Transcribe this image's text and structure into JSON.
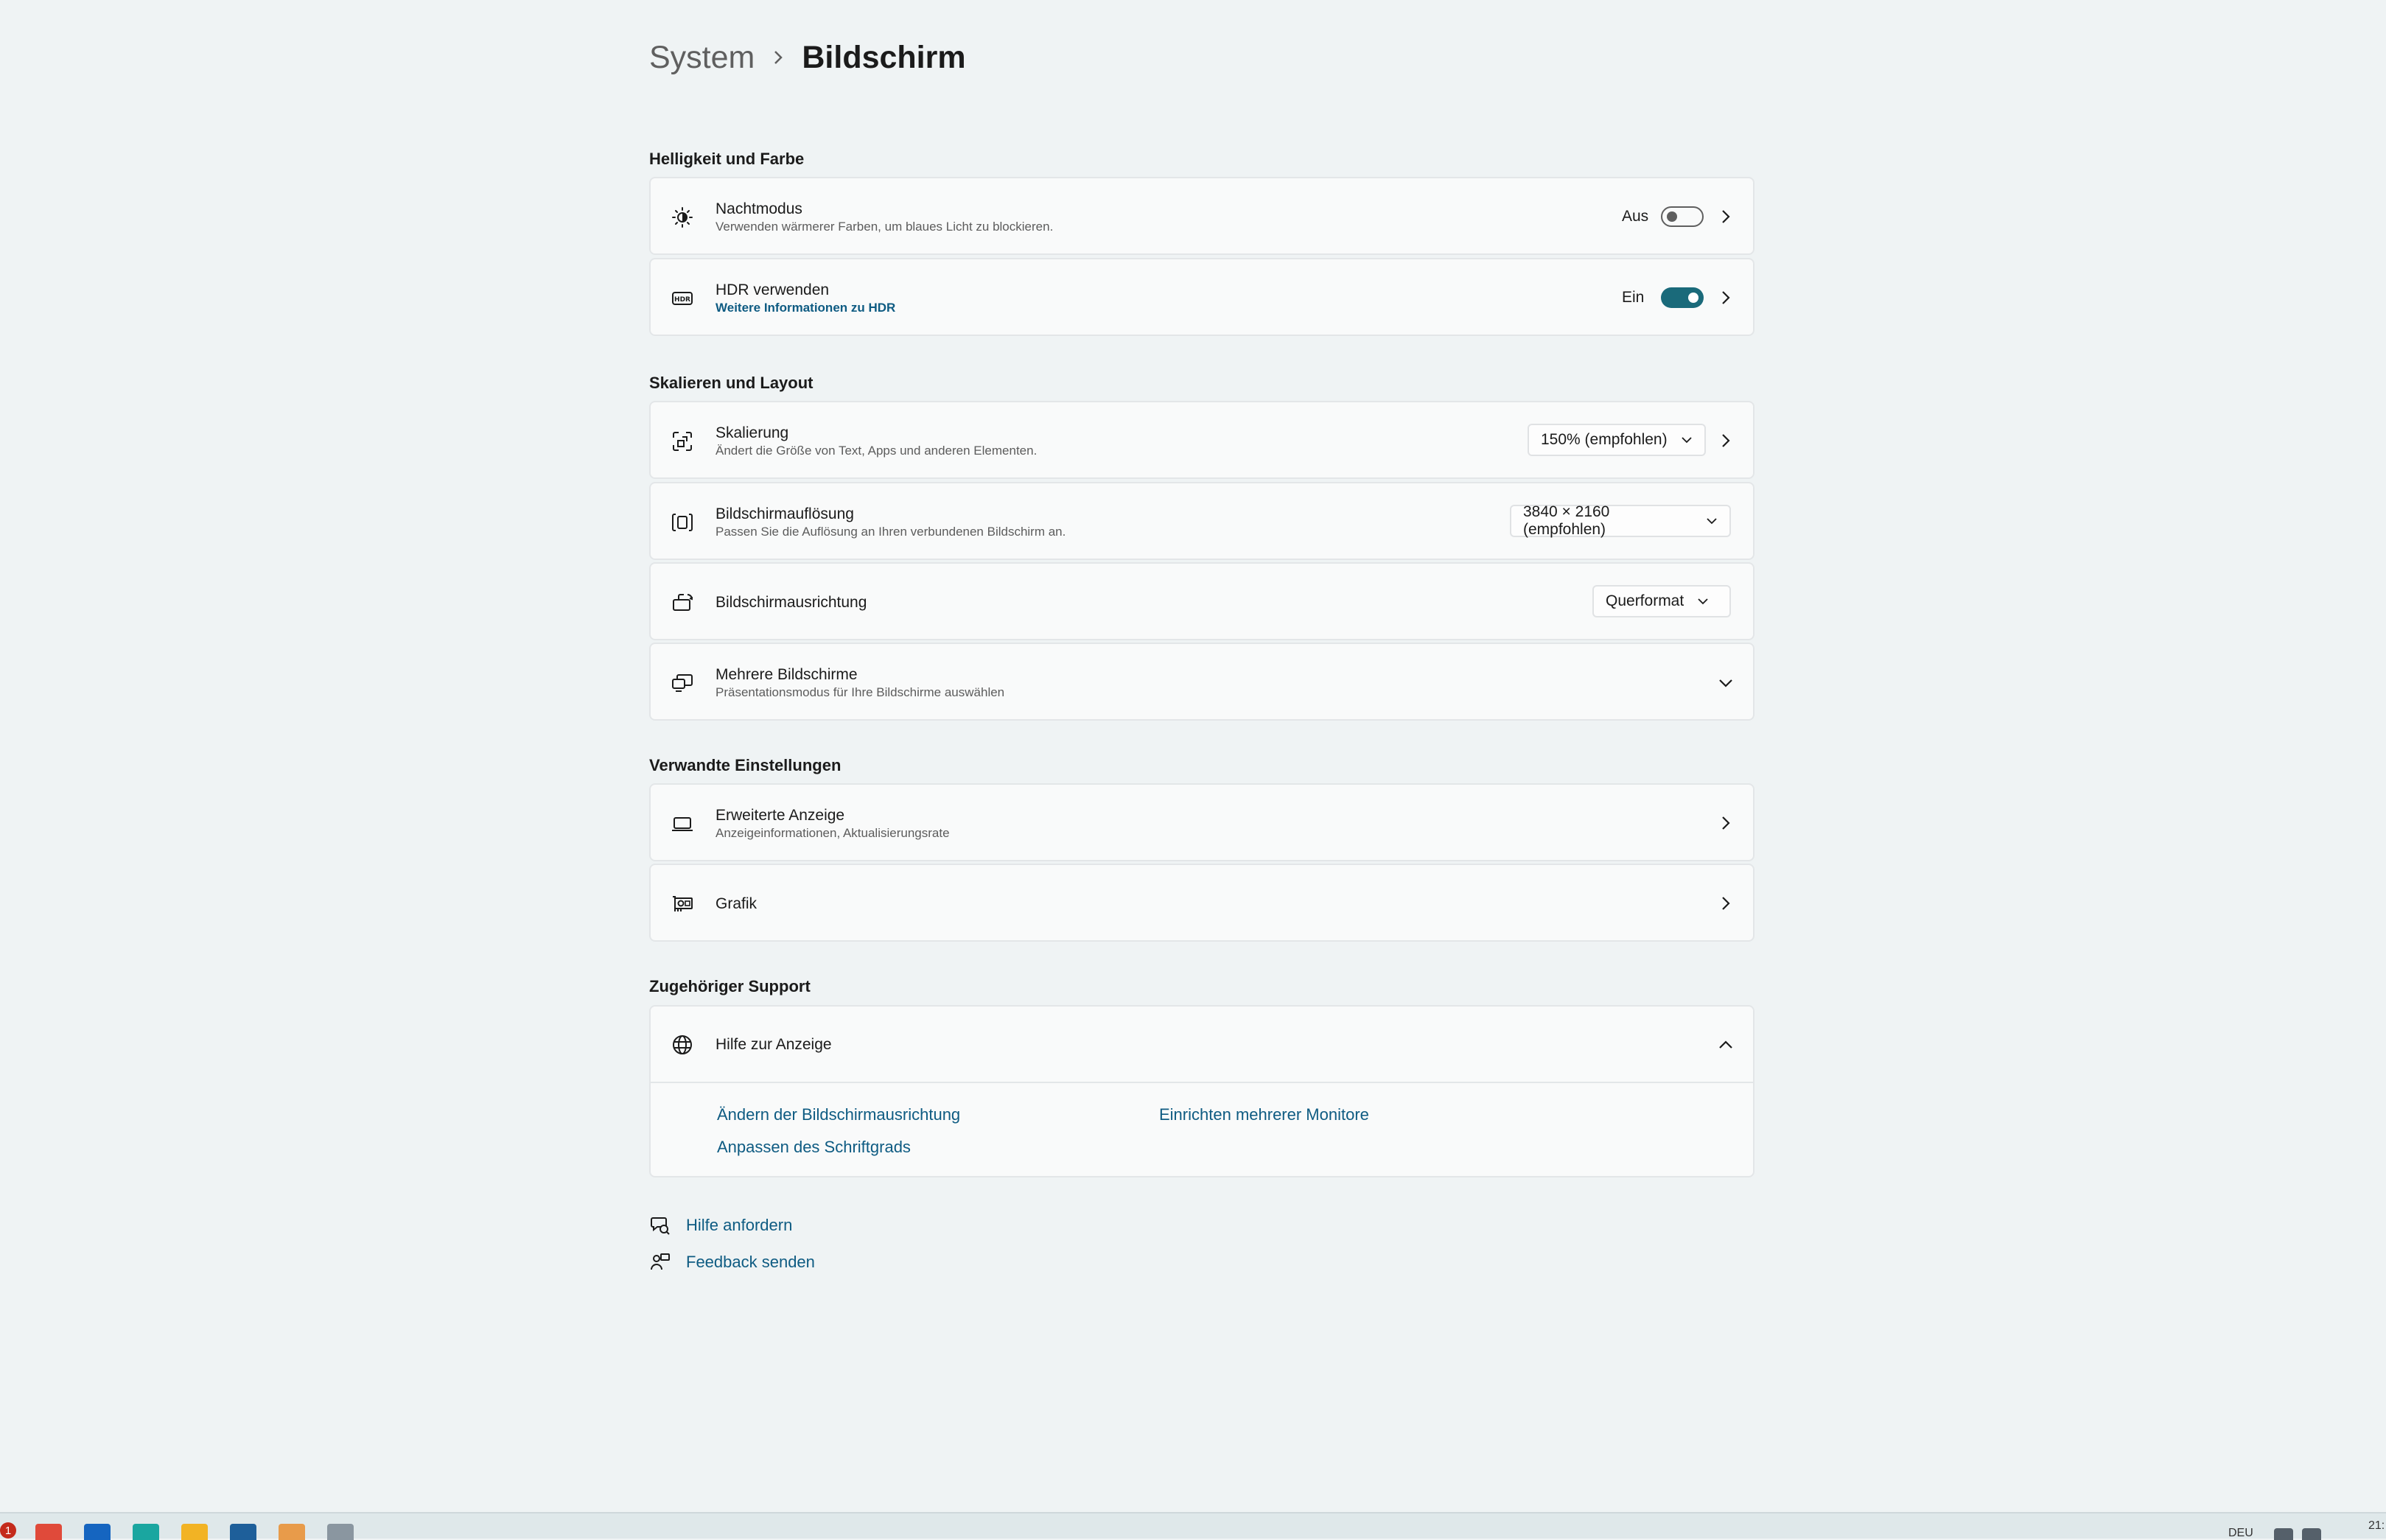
{
  "breadcrumb": {
    "root": "System",
    "current": "Bildschirm"
  },
  "sections": {
    "brightness": "Helligkeit und Farbe",
    "scale": "Skalieren und Layout",
    "related": "Verwandte Einstellungen",
    "support": "Zugehöriger Support"
  },
  "night_mode": {
    "title": "Nachtmodus",
    "subtitle": "Verwenden wärmerer Farben, um blaues Licht zu blockieren.",
    "state_label": "Aus",
    "enabled": false,
    "icon": "brightness-icon"
  },
  "hdr": {
    "title": "HDR verwenden",
    "link": "Weitere Informationen zu HDR",
    "state_label": "Ein",
    "enabled": true,
    "icon": "hdr-icon"
  },
  "scaling": {
    "title": "Skalierung",
    "subtitle": "Ändert die Größe von Text, Apps und anderen Elementen.",
    "value": "150% (empfohlen)",
    "icon": "scaling-icon"
  },
  "resolution": {
    "title": "Bildschirmauflösung",
    "subtitle": "Passen Sie die Auflösung an Ihren verbundenen Bildschirm an.",
    "value": "3840 × 2160 (empfohlen)",
    "icon": "resolution-icon"
  },
  "orientation": {
    "title": "Bildschirmausrichtung",
    "value": "Querformat",
    "icon": "orientation-icon"
  },
  "multi_display": {
    "title": "Mehrere Bildschirme",
    "subtitle": "Präsentationsmodus für Ihre Bildschirme auswählen",
    "icon": "multiple-displays-icon"
  },
  "advanced_display": {
    "title": "Erweiterte Anzeige",
    "subtitle": "Anzeigeinformationen, Aktualisierungsrate",
    "icon": "laptop-icon"
  },
  "graphics": {
    "title": "Grafik",
    "icon": "graphics-card-icon"
  },
  "help_display": {
    "title": "Hilfe zur Anzeige",
    "icon": "globe-icon",
    "links": [
      "Ändern der Bildschirmausrichtung",
      "Einrichten mehrerer Monitore",
      "Anpassen des Schriftgrads"
    ]
  },
  "footer": {
    "get_help": "Hilfe anfordern",
    "feedback": "Feedback senden"
  },
  "taskbar": {
    "badge": "1",
    "lang": "DEU",
    "clock": "21:"
  },
  "colors": {
    "accent": "#1a6a7a",
    "link": "#0e5b82",
    "background": "#eff3f4",
    "card": "#f9fafa"
  }
}
